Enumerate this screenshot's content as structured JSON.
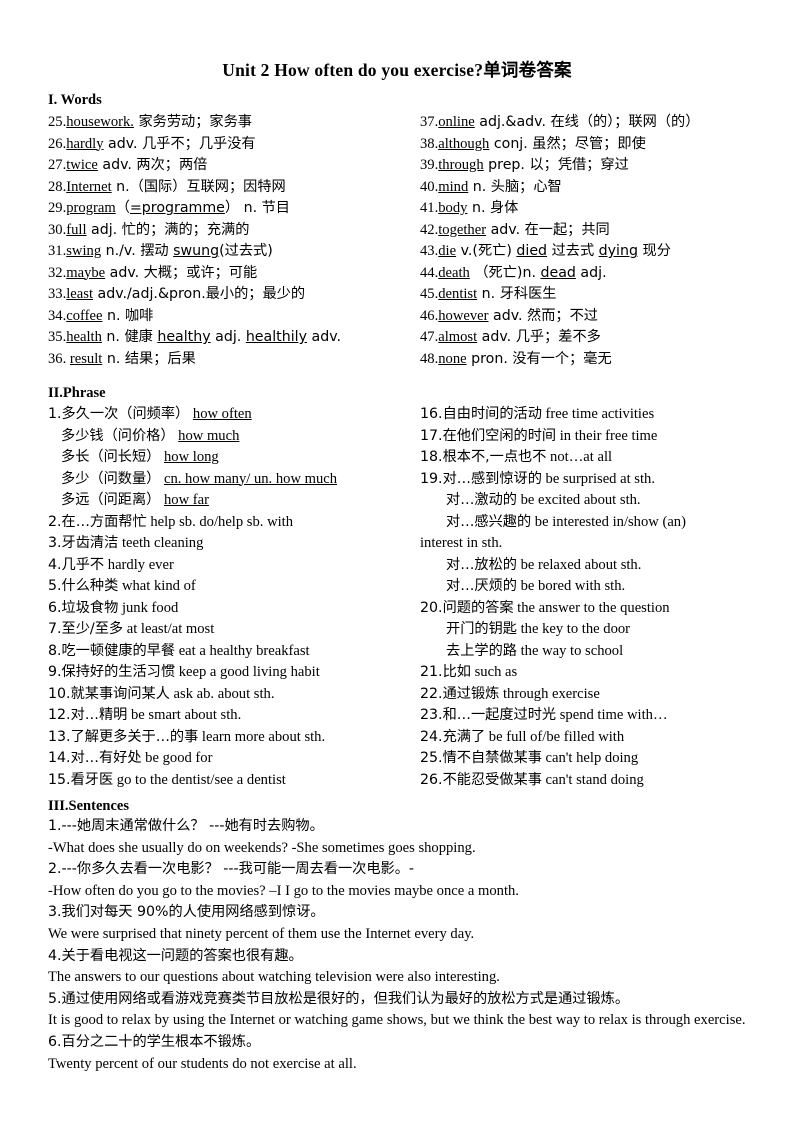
{
  "document": {
    "title": "Unit 2 How often do you exercise?单词卷答案"
  },
  "sections": {
    "words": {
      "heading": "I. Words",
      "left": [
        {
          "num": "25.",
          "word": "housework.",
          "underline": true,
          "rest": " 家务劳动；家务事"
        },
        {
          "num": "26.",
          "word": "hardly",
          "underline": true,
          "rest": "  adv.  几乎不；几乎没有"
        },
        {
          "num": "27.",
          "word": "twice",
          "underline": true,
          "rest": "   adv.  两次；两倍"
        },
        {
          "num": "28.",
          "word": "Internet",
          "underline": true,
          "rest": "   n.（国际）互联网；因特网"
        },
        {
          "num": "29.",
          "word": "program",
          "underline": true,
          "rest": "（=programme）   n. 节目",
          "inner_underline": "=programme"
        },
        {
          "num": "30.",
          "word": "full",
          "underline": true,
          "rest": "   adj. 忙的；满的；充满的"
        },
        {
          "num": "31.",
          "word": "swing",
          "underline": true,
          "rest": "   n./v.  摆动  swung(过去式)",
          "inner_underline": "swung"
        },
        {
          "num": "32.",
          "word": "maybe",
          "underline": true,
          "rest": "  adv. 大概；或许；可能"
        },
        {
          "num": "33.",
          "word": "least",
          "underline": true,
          "rest": "  adv./adj.&pron.最小的；最少的"
        },
        {
          "num": "34.",
          "word": "coffee",
          "underline": true,
          "rest": " n. 咖啡"
        },
        {
          "num": "35.",
          "word": "health",
          "underline": true,
          "rest": " n. 健康  healthy  adj.  healthily  adv.",
          "inner_underline": "healthy healthily"
        },
        {
          "num": "36. ",
          "word": "result",
          "underline": true,
          "rest": " n. 结果；后果"
        }
      ],
      "right": [
        {
          "num": "37.",
          "word": "online",
          "underline": true,
          "rest": " adj.&adv. 在线（的）；联网（的）"
        },
        {
          "num": "38.",
          "word": "although",
          "underline": true,
          "rest": "   conj. 虽然；尽管；即使"
        },
        {
          "num": "39.",
          "word": "through",
          "underline": true,
          "rest": " prep. 以；凭借；穿过"
        },
        {
          "num": "40.",
          "word": "mind",
          "underline": true,
          "rest": "   n. 头脑；心智"
        },
        {
          "num": "41.",
          "word": "body",
          "underline": true,
          "rest": "   n. 身体"
        },
        {
          "num": "42.",
          "word": "together",
          "underline": true,
          "rest": "   adv. 在一起；共同"
        },
        {
          "num": "43.",
          "word": "die",
          "underline": true,
          "rest": " v.(死亡) died  过去式  dying 现分",
          "inner_underline": "died dying"
        },
        {
          "num": "44.",
          "word": "death",
          "underline": true,
          "rest": "   （死亡)n. dead adj.",
          "inner_underline": "dead"
        },
        {
          "num": "45.",
          "word": "dentist",
          "underline": true,
          "rest": " n. 牙科医生"
        },
        {
          "num": "46.",
          "word": "however",
          "underline": true,
          "rest": "   adv. 然而；不过"
        },
        {
          "num": "47.",
          "word": "almost",
          "underline": true,
          "rest": "   adv. 几乎；差不多"
        },
        {
          "num": "48.",
          "word": "none",
          "underline": true,
          "rest": "   pron. 没有一个；毫无"
        }
      ]
    },
    "phrase": {
      "heading": "II.Phrase",
      "left": [
        {
          "indent": 0,
          "zh": "1.多久一次（问频率）",
          "en": "how often",
          "underline": true
        },
        {
          "indent": 1,
          "zh": "多少钱（问价格）",
          "en": "how much",
          "underline": true
        },
        {
          "indent": 1,
          "zh": "多长（问长短）",
          "en": "how long",
          "underline": true
        },
        {
          "indent": 1,
          "zh": "多少（问数量）",
          "en": "cn. how many/ un. how much",
          "underline": true
        },
        {
          "indent": 1,
          "zh": "多远（问距离）",
          "en": "how far",
          "underline": true
        },
        {
          "indent": 0,
          "zh": "2.在…方面帮忙",
          "en": "help sb. do/help sb. with",
          "underline": false
        },
        {
          "indent": 0,
          "zh": "3.牙齿清洁",
          "en": "teeth cleaning",
          "underline": false
        },
        {
          "indent": 0,
          "zh": "4.几乎不",
          "en": "hardly ever",
          "underline": false
        },
        {
          "indent": 0,
          "zh": "5.什么种类",
          "en": "  what kind of",
          "underline": false
        },
        {
          "indent": 0,
          "zh": "6.垃圾食物",
          "en": "junk food",
          "underline": false
        },
        {
          "indent": 0,
          "zh": "7.至少/至多",
          "en": "at least/at most",
          "underline": false
        },
        {
          "indent": 0,
          "zh": "8.吃一顿健康的早餐",
          "en": "eat a healthy breakfast",
          "underline": false
        },
        {
          "indent": 0,
          "zh": "9.保持好的生活习惯",
          "en": "keep a good living habit",
          "underline": false
        },
        {
          "indent": 0,
          "zh": "10.就某事询问某人",
          "en": "ask ab. about sth.",
          "underline": false
        },
        {
          "indent": 0,
          "zh": "12.对…精明",
          "en": "be smart about sth.",
          "underline": false
        },
        {
          "indent": 0,
          "zh": "13.了解更多关于…的事",
          "en": "learn more about sth.",
          "underline": false
        },
        {
          "indent": 0,
          "zh": "14.对…有好处",
          "en": "be good for",
          "underline": false
        },
        {
          "indent": 0,
          "zh": "15.看牙医",
          "en": "go to the dentist/see a dentist",
          "underline": false
        }
      ],
      "right": [
        {
          "indent": 0,
          "zh": "16.自由时间的活动",
          "en": "free time activities",
          "underline": false
        },
        {
          "indent": 0,
          "zh": "17.在他们空闲的时间",
          "en": "in their free time",
          "underline": false
        },
        {
          "indent": 0,
          "zh": "18.根本不,一点也不",
          "en": "not…at all",
          "underline": false
        },
        {
          "indent": 0,
          "zh": "19.对…感到惊讶的",
          "en": "be surprised at sth.",
          "underline": false
        },
        {
          "indent": 2,
          "zh": "对…激动的",
          "en": "be excited about sth.",
          "underline": false
        },
        {
          "indent": 2,
          "zh": "对…感兴趣的",
          "en": "be interested in/show (an)",
          "underline": false
        },
        {
          "indent": -1,
          "zh": "",
          "en": "interest in sth.",
          "underline": false
        },
        {
          "indent": 2,
          "zh": "对…放松的",
          "en": "be relaxed about sth.",
          "underline": false
        },
        {
          "indent": 2,
          "zh": "对…厌烦的",
          "en": "be bored with sth.",
          "underline": false
        },
        {
          "indent": 0,
          "zh": "20.问题的答案",
          "en": "the answer to the question",
          "underline": false
        },
        {
          "indent": 2,
          "zh": "开门的钥匙",
          "en": "the key to the door",
          "underline": false
        },
        {
          "indent": 2,
          "zh": "去上学的路",
          "en": "the way to school",
          "underline": false
        },
        {
          "indent": 0,
          "zh": "21.比如",
          "en": "such as",
          "underline": false
        },
        {
          "indent": 0,
          "zh": "22.通过锻炼",
          "en": "through exercise",
          "underline": false
        },
        {
          "indent": 0,
          "zh": "23.和…一起度过时光",
          "en": "spend time with…",
          "underline": false
        },
        {
          "indent": 0,
          "zh": "24.充满了",
          "en": " be full of/be filled with",
          "underline": false
        },
        {
          "indent": 0,
          "zh": "25.情不自禁做某事",
          "en": "can't help doing",
          "underline": false
        },
        {
          "indent": 0,
          "zh": "26.不能忍受做某事",
          "en": "can't stand doing",
          "underline": false
        }
      ]
    },
    "sentences": {
      "heading": "III.Sentences",
      "items": [
        {
          "zh": "1.---她周末通常做什么？   ---她有时去购物。",
          "en": "-What does she usually do on weekends?       -She sometimes goes shopping.",
          "justify": false
        },
        {
          "zh": "2.---你多久去看一次电影？   ---我可能一周去看一次电影。-",
          "en": "-How often do you go to the movies? –I I go to the movies maybe once a month.",
          "justify": false
        },
        {
          "zh": "3.我们对每天 90%的人使用网络感到惊讶。",
          "en": "We were surprised that ninety percent of them use the Internet every day.",
          "justify": false
        },
        {
          "zh": "4.关于看电视这一问题的答案也很有趣。",
          "en": "The answers to our questions about watching television were also interesting.",
          "justify": false
        },
        {
          "zh": "5.通过使用网络或看游戏竞赛类节目放松是很好的，但我们认为最好的放松方式是通过锻炼。",
          "en": "It is good to relax by using the Internet or watching game shows, but we think the best way to relax is through exercise.",
          "justify": true
        },
        {
          "zh": "6.百分之二十的学生根本不锻炼。",
          "en": "Twenty percent of our students do not exercise at all.",
          "justify": false
        }
      ]
    }
  }
}
